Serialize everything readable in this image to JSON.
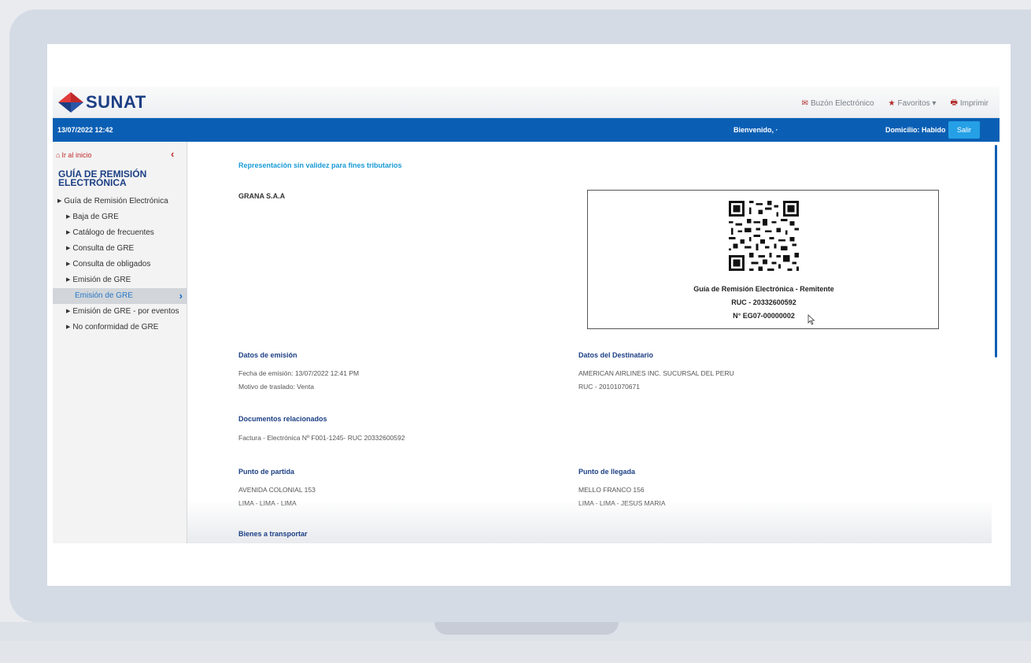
{
  "header": {
    "logo_text": "SUNAT",
    "links": [
      {
        "label": "Buzón Electrónico",
        "icon": "envelope-icon"
      },
      {
        "label": "Favoritos ▾",
        "icon": "star-icon"
      },
      {
        "label": "Imprimir",
        "icon": "printer-icon"
      }
    ]
  },
  "bluebar": {
    "datetime": "13/07/2022 12:42",
    "welcome": "Bienvenido, ·",
    "domicilio": "Domicilio: Habido",
    "salir": "Salir"
  },
  "sidebar": {
    "home": "Ir al inicio",
    "collapse": "‹",
    "title": "GUÍA DE REMISIÓN ELECTRÓNICA",
    "items": [
      {
        "label": "Guía de Remisión Electrónica",
        "level": 1
      },
      {
        "label": "Baja de GRE",
        "level": 2
      },
      {
        "label": "Catálogo de frecuentes",
        "level": 2
      },
      {
        "label": "Consulta de GRE",
        "level": 2
      },
      {
        "label": "Consulta de obligados",
        "level": 2
      },
      {
        "label": "Emisión de GRE",
        "level": 2
      },
      {
        "label": "Emisión de GRE",
        "level": 3,
        "active": true
      },
      {
        "label": "Emisión de GRE - por eventos",
        "level": 2
      },
      {
        "label": "No conformidad de GRE",
        "level": 2
      }
    ]
  },
  "content": {
    "note": "Representación sin validez para fines tributarios",
    "company": "GRANA S.A.A",
    "qr_box": {
      "line1": "Guía de Remisión Electrónica - Remitente",
      "line2": "RUC - 20332600592",
      "line3": "N° EG07-00000002"
    },
    "emision": {
      "heading": "Datos de emisión",
      "fecha": "Fecha de emisión: 13/07/2022 12:41 PM",
      "motivo": "Motivo de traslado: Venta"
    },
    "destinatario": {
      "heading": "Datos del Destinatario",
      "name": "AMERICAN AIRLINES INC. SUCURSAL DEL PERU",
      "ruc": "RUC - 20101070671"
    },
    "documentos": {
      "heading": "Documentos relacionados",
      "item": "Factura - Electrónica Nº F001-1245- RUC 20332600592"
    },
    "partida": {
      "heading": "Punto de partida",
      "line1": "AVENIDA COLONIAL 153",
      "line2": "LIMA - LIMA - LIMA"
    },
    "llegada": {
      "heading": "Punto de llegada",
      "line1": "MELLO FRANCO 156",
      "line2": "LIMA - LIMA - JESUS MARIA"
    },
    "bienes": "Bienes a transportar"
  },
  "colors": {
    "brand_blue": "#1c3f84",
    "bar_blue": "#0a5fb4",
    "accent_red": "#c12a2a",
    "link_cyan": "#1a9bd6"
  }
}
